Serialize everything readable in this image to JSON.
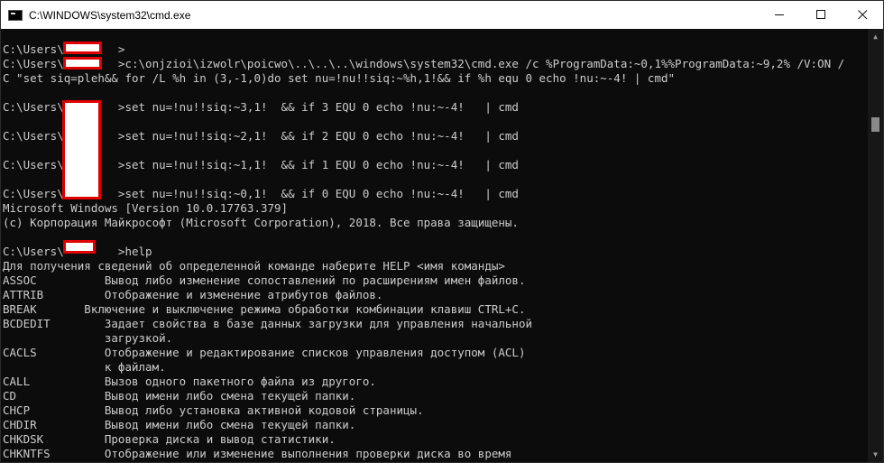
{
  "window": {
    "title": "C:\\WINDOWS\\system32\\cmd.exe",
    "app_icon": "console-icon",
    "controls": [
      "minimize-icon",
      "maximize-icon",
      "close-icon"
    ]
  },
  "console": {
    "lines": [
      "C:\\Users\\        >",
      "C:\\Users\\        >c:\\onjzioi\\izwolr\\poicwo\\..\\..\\..\\windows\\system32\\cmd.exe /c %ProgramData:~0,1%%ProgramData:~9,2% /V:ON /",
      "C \"set siq=pleh&& for /L %h in (3,-1,0)do set nu=!nu!!siq:~%h,1!&& if %h equ 0 echo !nu:~-4! | cmd\"",
      "",
      "C:\\Users\\        >set nu=!nu!!siq:~3,1!  && if 3 EQU 0 echo !nu:~-4!   | cmd",
      "",
      "C:\\Users\\        >set nu=!nu!!siq:~2,1!  && if 2 EQU 0 echo !nu:~-4!   | cmd",
      "",
      "C:\\Users\\        >set nu=!nu!!siq:~1,1!  && if 1 EQU 0 echo !nu:~-4!   | cmd",
      "",
      "C:\\Users\\        >set nu=!nu!!siq:~0,1!  && if 0 EQU 0 echo !nu:~-4!   | cmd",
      "Microsoft Windows [Version 10.0.17763.379]",
      "(c) Корпорация Майкрософт (Microsoft Corporation), 2018. Все права защищены.",
      "",
      "C:\\Users\\        >help",
      "Для получения сведений об определенной команде наберите HELP <имя команды>",
      "ASSOC          Вывод либо изменение сопоставлений по расширениям имен файлов.",
      "ATTRIB         Отображение и изменение атрибутов файлов.",
      "BREAK       Включение и выключение режима обработки комбинации клавиш CTRL+C.",
      "BCDEDIT        Задает свойства в базе данных загрузки для управления начальной",
      "               загрузкой.",
      "CACLS          Отображение и редактирование списков управления доступом (ACL)",
      "               к файлам.",
      "CALL           Вызов одного пакетного файла из другого.",
      "CD             Вывод имени либо смена текущей папки.",
      "CHCP           Вывод либо установка активной кодовой страницы.",
      "CHDIR          Вывод имени либо смена текущей папки.",
      "CHKDSK         Проверка диска и вывод статистики.",
      "CHKNTFS        Отображение или изменение выполнения проверки диска во время"
    ]
  },
  "colors": {
    "console_bg": "#0c0c0c",
    "console_text": "#cccccc",
    "redaction_fill": "#ffffff",
    "redaction_border": "#e00000"
  }
}
